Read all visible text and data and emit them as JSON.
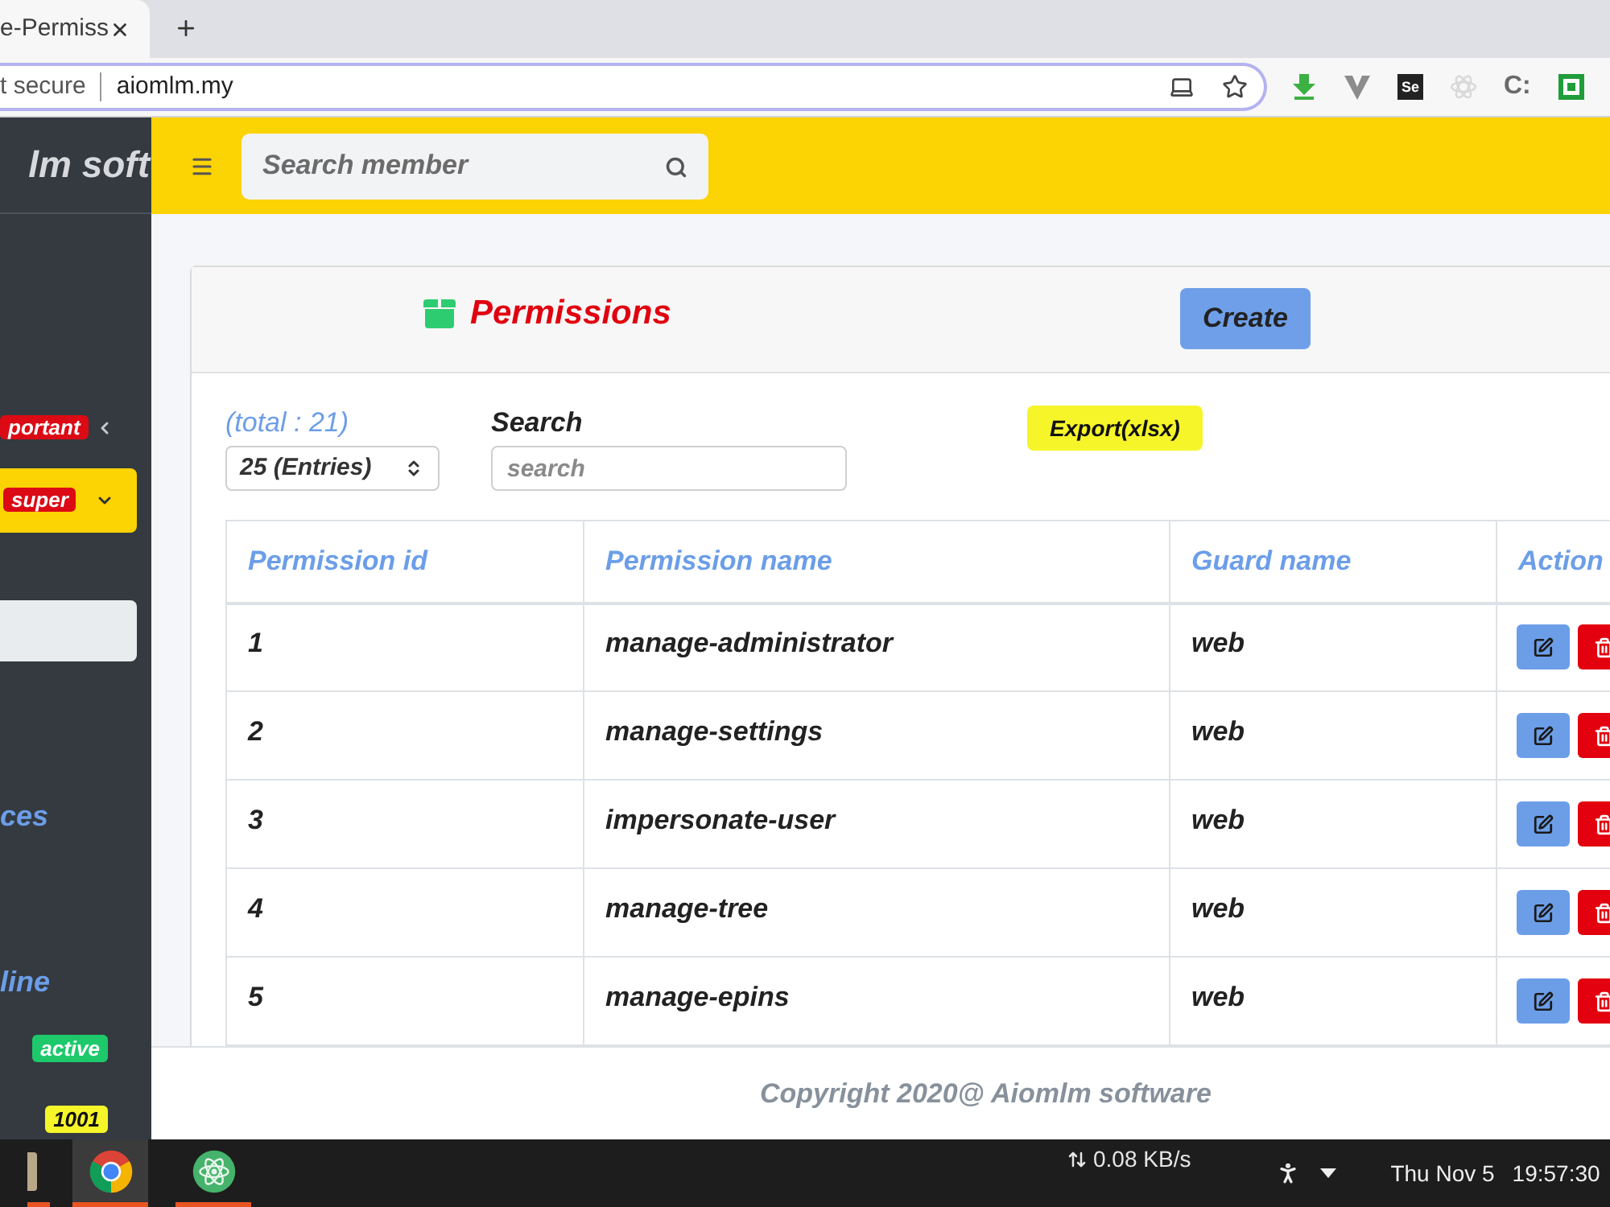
{
  "browser": {
    "tab": {
      "title": "e-Permiss"
    },
    "address": {
      "security": "t secure",
      "url": "aiomlm.my"
    },
    "extensions": [
      {
        "kind": "download"
      },
      {
        "kind": "vee"
      },
      {
        "kind": "badge",
        "label": "Se"
      },
      {
        "kind": "atom"
      },
      {
        "kind": "text",
        "label": "C:"
      },
      {
        "kind": "square"
      }
    ]
  },
  "sidebar": {
    "brand": "lm soft",
    "items": [
      {
        "kind": "menu",
        "badge": {
          "text": "portant",
          "color": "#dc0a14"
        },
        "selected": false,
        "expanded": false
      },
      {
        "kind": "menu",
        "badge": {
          "text": "super",
          "color": "#dc0a14"
        },
        "selected": true,
        "expanded": true,
        "children": [
          {
            "selected": true
          }
        ]
      },
      {
        "kind": "label",
        "label": "ces"
      },
      {
        "kind": "label",
        "label": "line"
      },
      {
        "kind": "badge",
        "badge": {
          "text": "active",
          "color": "#1ec96b"
        }
      },
      {
        "kind": "badge",
        "badge": {
          "text": "1001",
          "color": "#f5f52a"
        }
      }
    ]
  },
  "header": {
    "search": {
      "placeholder": "Search member"
    }
  },
  "card": {
    "title": "Permissions",
    "create_button": "Create",
    "total": "(total : 21)",
    "page_size": {
      "value": "25 (Entries)"
    },
    "search": {
      "label": "Search",
      "placeholder": "search"
    },
    "export_button": "Export(xlsx)",
    "table": {
      "columns": [
        "Permission id",
        "Permission name",
        "Guard name",
        "Action"
      ],
      "rows": [
        {
          "id": "1",
          "name": "manage-administrator",
          "guard": "web"
        },
        {
          "id": "2",
          "name": "manage-settings",
          "guard": "web"
        },
        {
          "id": "3",
          "name": "impersonate-user",
          "guard": "web"
        },
        {
          "id": "4",
          "name": "manage-tree",
          "guard": "web"
        },
        {
          "id": "5",
          "name": "manage-epins",
          "guard": "web"
        }
      ]
    }
  },
  "footer": {
    "text": "Copyright 2020@ Aiomlm software"
  },
  "taskbar": {
    "apps": [
      {
        "kind": "file",
        "selected": false,
        "running": true
      },
      {
        "kind": "browser",
        "selected": true,
        "running": true
      },
      {
        "kind": "atom",
        "selected": false,
        "running": true
      }
    ],
    "network": "0.08 KB/s",
    "date": "Thu Nov 5",
    "time": "19:57:30"
  }
}
